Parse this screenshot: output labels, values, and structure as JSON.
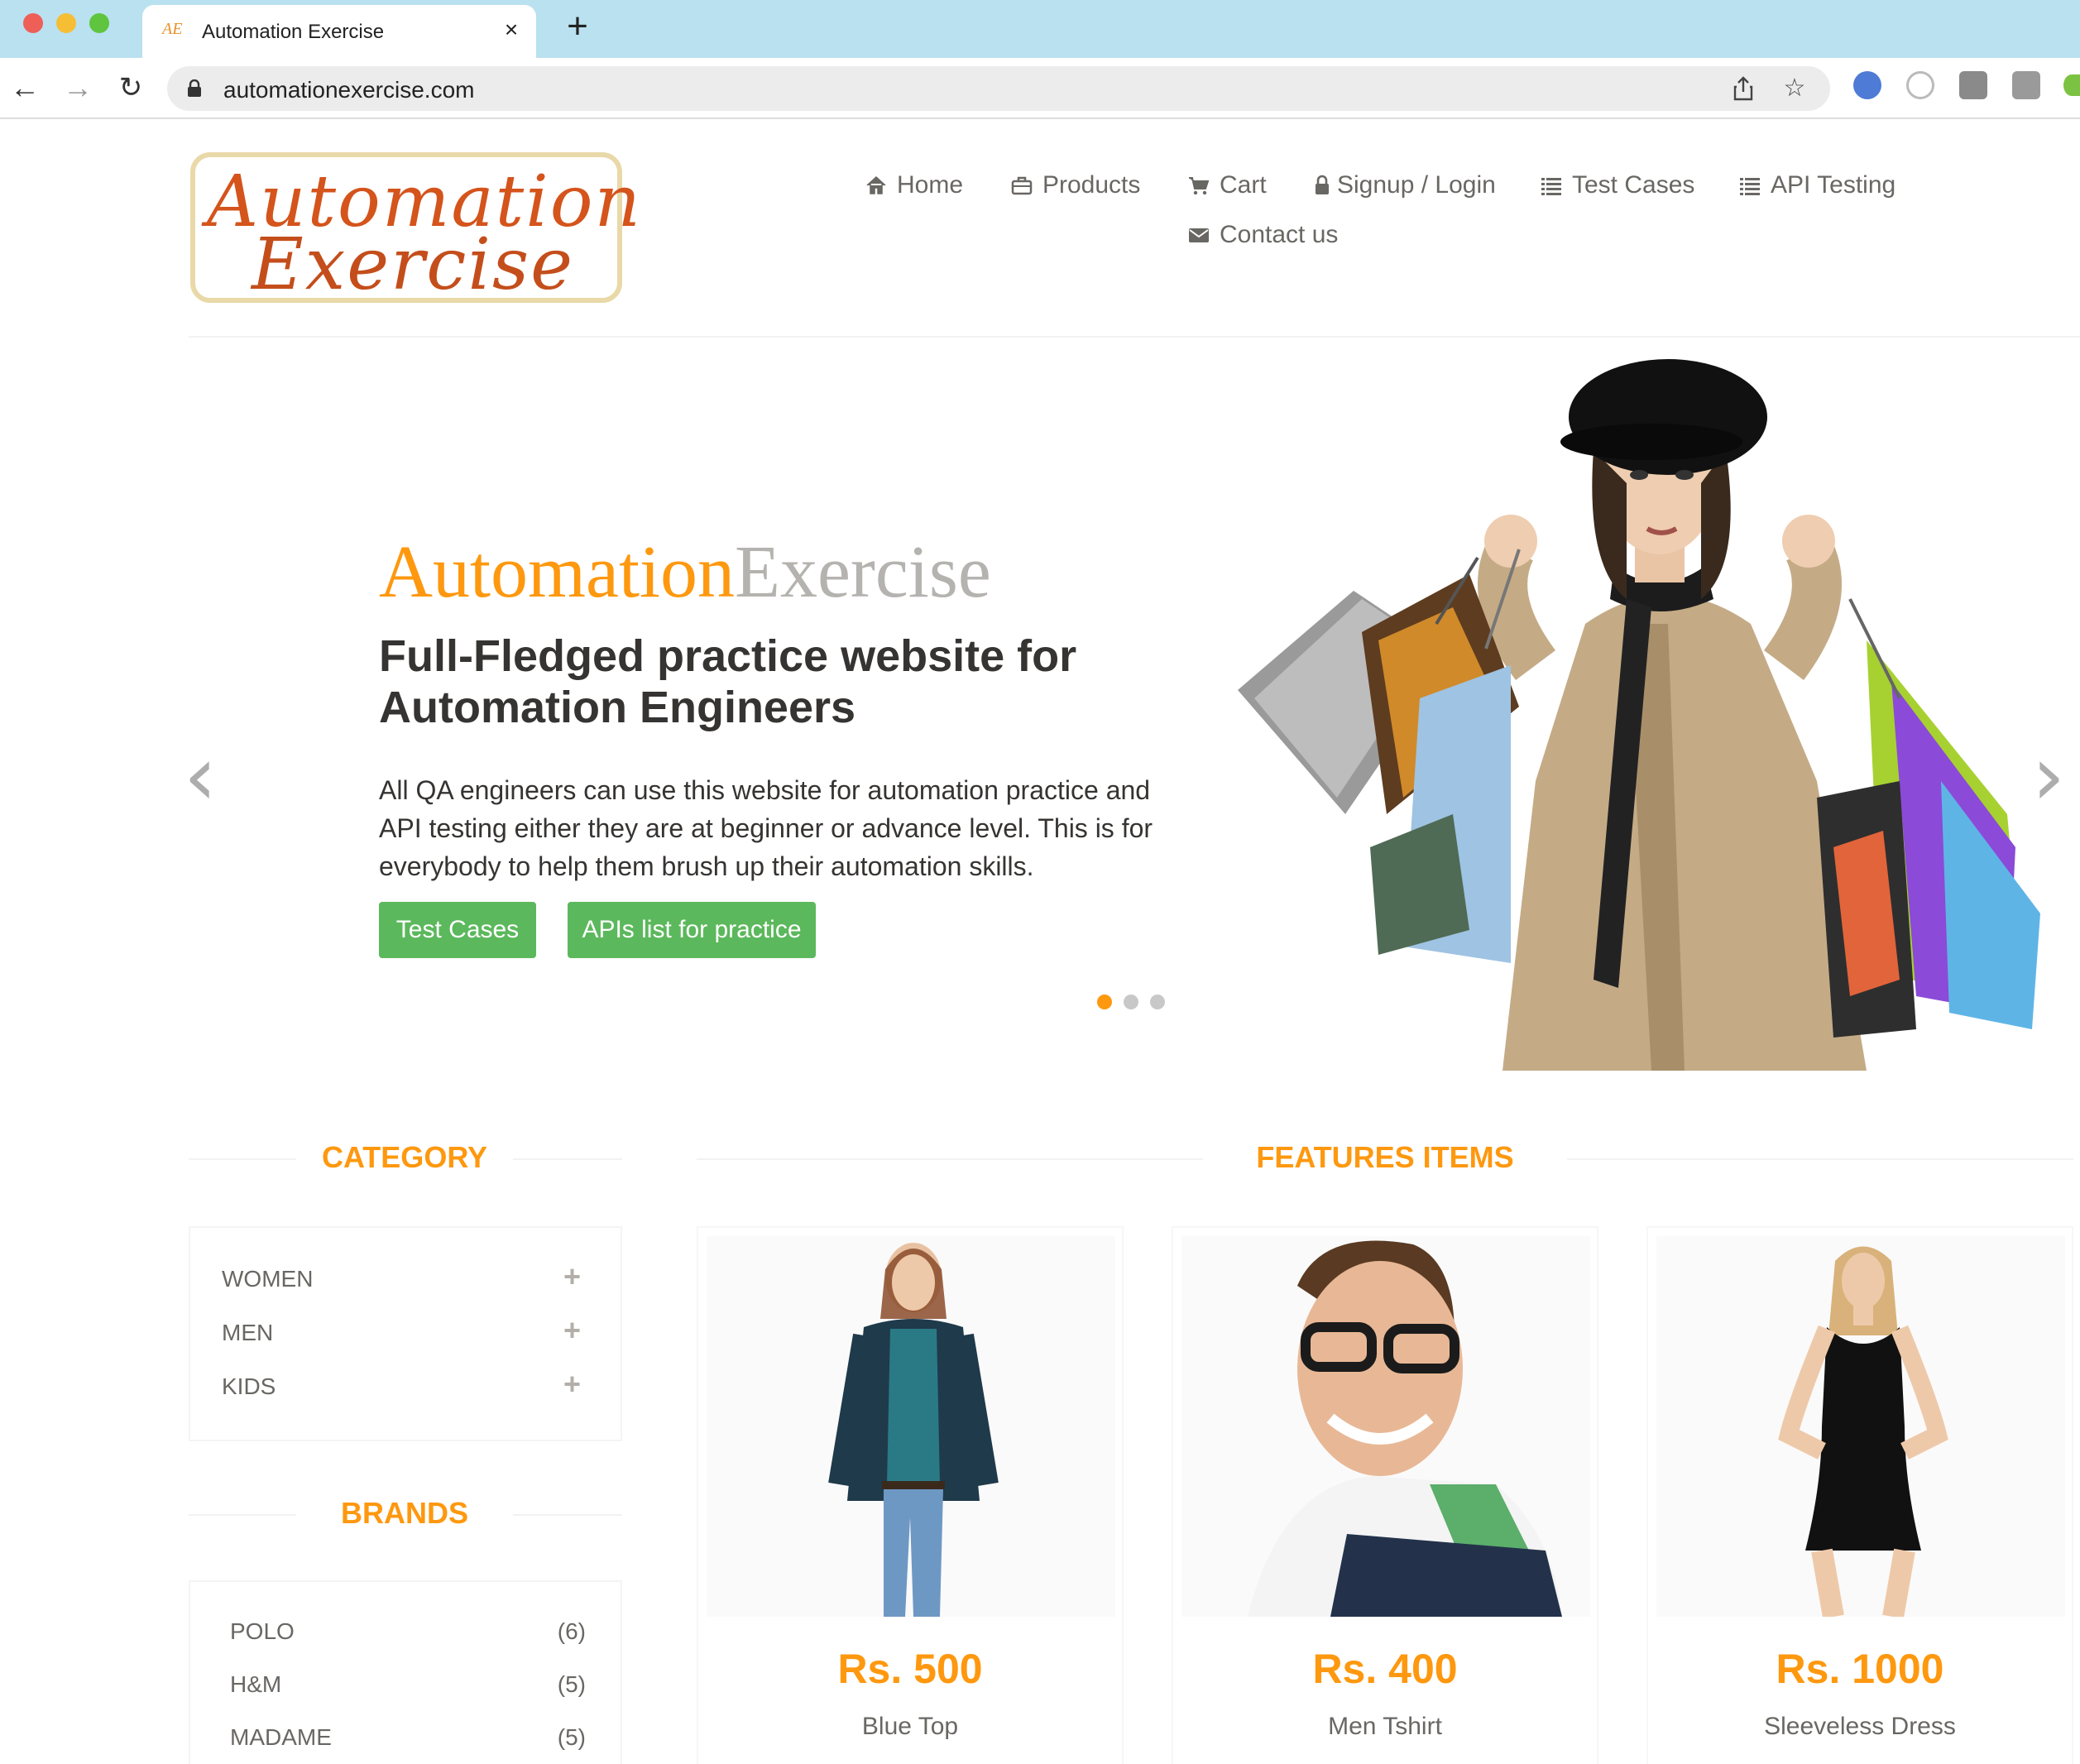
{
  "browser": {
    "tab_title": "Automation Exercise",
    "url": "automationexercise.com",
    "favicon_text": "AE"
  },
  "site": {
    "logo_line1": "Automation",
    "logo_line2": "Exercise",
    "nav": [
      {
        "label": "Home",
        "icon": "home-icon"
      },
      {
        "label": "Products",
        "icon": "briefcase-icon"
      },
      {
        "label": "Cart",
        "icon": "cart-icon"
      },
      {
        "label": "Signup / Login",
        "icon": "lock-icon"
      },
      {
        "label": "Test Cases",
        "icon": "list-icon"
      },
      {
        "label": "API Testing",
        "icon": "list-icon"
      },
      {
        "label": "Contact us",
        "icon": "envelope-icon"
      }
    ]
  },
  "slider": {
    "brand_part1": "Automation",
    "brand_part2": "Exercise",
    "heading": "Full-Fledged practice website for Automation Engineers",
    "text": "All QA engineers can use this website for automation practice and API testing either they are at beginner or advance level. This is for everybody to help them brush up their automation skills.",
    "button_test_cases": "Test Cases",
    "button_apis": "APIs list for practice",
    "active_slide": 1,
    "slide_count": 3
  },
  "sidebar": {
    "category_title": "CATEGORY",
    "categories": [
      "WOMEN",
      "MEN",
      "KIDS"
    ],
    "brands_title": "BRANDS",
    "brands": [
      {
        "name": "POLO",
        "count": "(6)"
      },
      {
        "name": "H&M",
        "count": "(5)"
      },
      {
        "name": "MADAME",
        "count": "(5)"
      }
    ]
  },
  "features": {
    "title": "FEATURES ITEMS",
    "products": [
      {
        "price": "Rs. 500",
        "name": "Blue Top"
      },
      {
        "price": "Rs. 400",
        "name": "Men Tshirt"
      },
      {
        "price": "Rs. 1000",
        "name": "Sleeveless Dress"
      }
    ]
  },
  "colors": {
    "accent": "#fe980f",
    "button_green": "#5cb85c",
    "brand_grey": "#b5b3af",
    "chrome_tab_bar": "#b9e1f0"
  }
}
